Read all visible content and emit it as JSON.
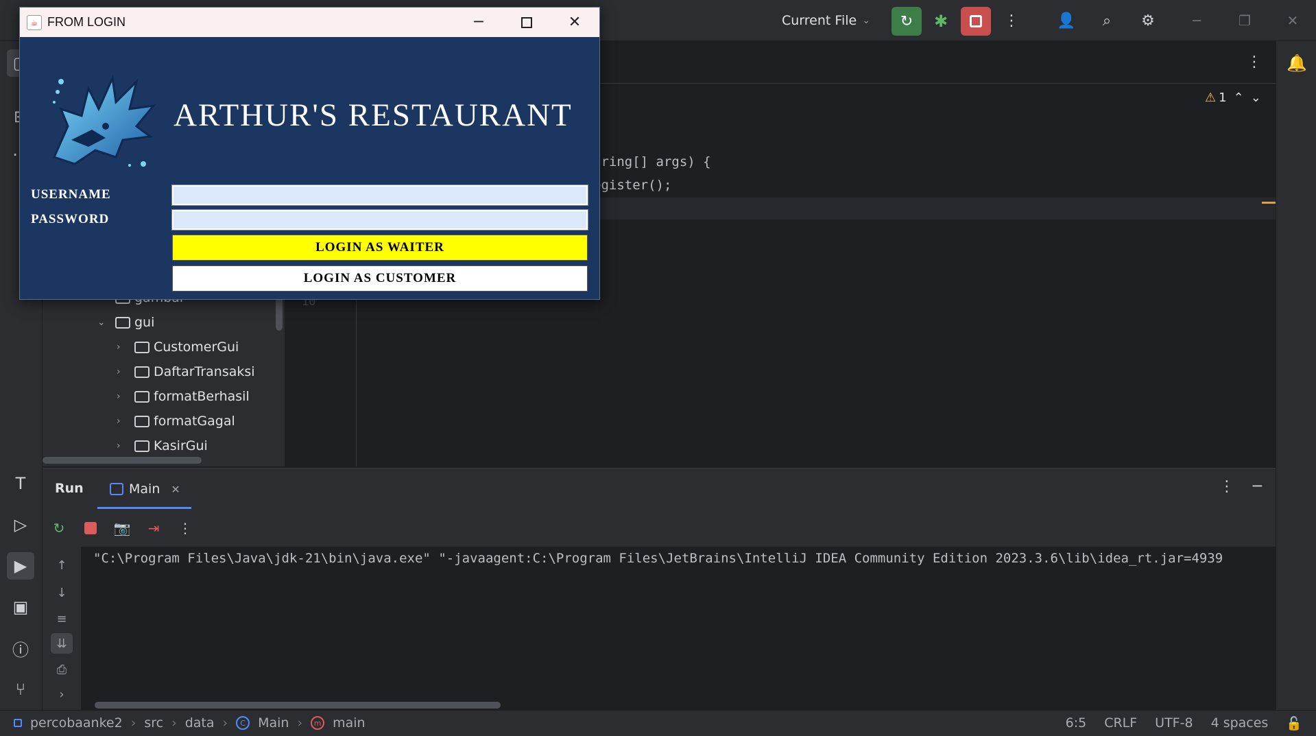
{
  "ide": {
    "run_config": "Current File",
    "project_tree": [
      {
        "label": "gambar",
        "type": "folder",
        "expanded": false
      },
      {
        "label": "gui",
        "type": "folder",
        "expanded": true
      },
      {
        "label": "CustomerGui",
        "type": "form",
        "expanded": false
      },
      {
        "label": "DaftarTransaksi",
        "type": "form",
        "expanded": false
      },
      {
        "label": "formatBerhasil",
        "type": "form",
        "expanded": false
      },
      {
        "label": "formatGagal",
        "type": "form",
        "expanded": false
      },
      {
        "label": "KasirGui",
        "type": "form",
        "expanded": false
      }
    ],
    "code_lines": [
      "tring[] args) {",
      "egister();"
    ],
    "line_number": "10",
    "warning_count": "1",
    "run_panel": {
      "title": "Run",
      "tab_label": "Main",
      "console_output": "\"C:\\Program Files\\Java\\jdk-21\\bin\\java.exe\" \"-javaagent:C:\\Program Files\\JetBrains\\IntelliJ IDEA Community Edition 2023.3.6\\lib\\idea_rt.jar=4939"
    },
    "statusbar": {
      "breadcrumb": [
        "percobaanke2",
        "src",
        "data",
        "Main",
        "main"
      ],
      "position": "6:5",
      "line_ending": "CRLF",
      "encoding": "UTF-8",
      "indent": "4 spaces"
    }
  },
  "dialog": {
    "window_title": "FROM LOGIN",
    "brand_title": "ARTHUR'S RESTAURANT",
    "username_label": "USERNAME",
    "password_label": "PASSWORD",
    "username_value": "",
    "password_value": "",
    "login_waiter_label": "LOGIN AS WAITER",
    "login_customer_label": "LOGIN AS CUSTOMER",
    "colors": {
      "background": "#1b3661",
      "waiter_button": "#ffff00",
      "customer_button": "#ffffff",
      "field": "#dbe8fb"
    }
  }
}
